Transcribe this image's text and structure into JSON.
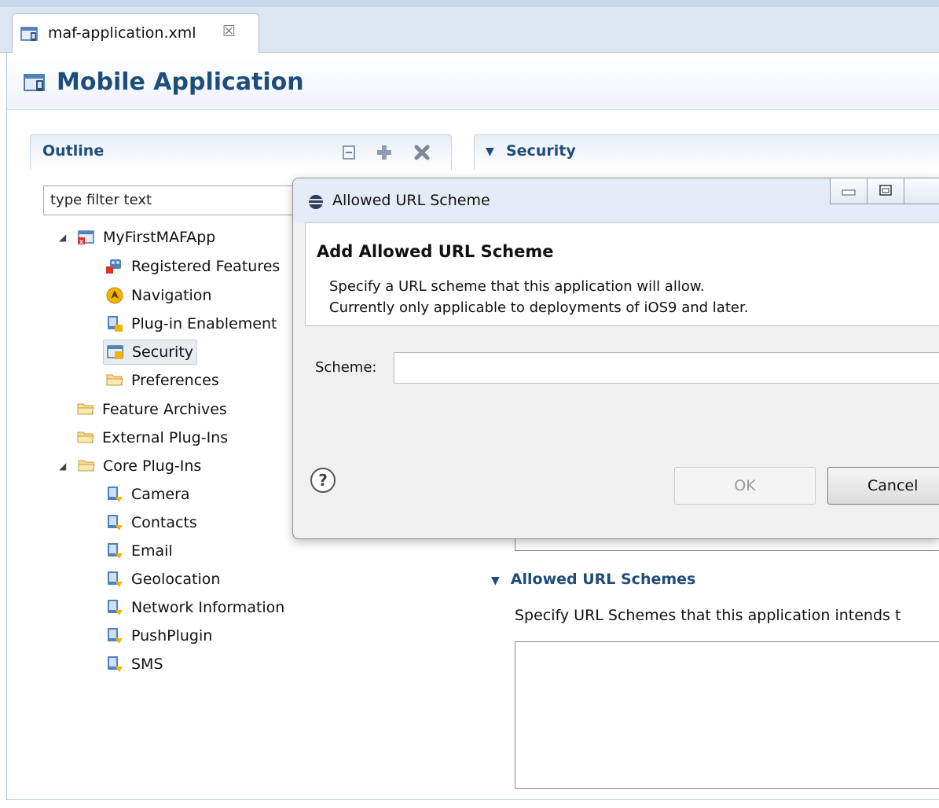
{
  "editor_tab": {
    "label": "maf-application.xml",
    "close": "☒"
  },
  "header": {
    "title": "Mobile Application"
  },
  "outline": {
    "title": "Outline",
    "filter_placeholder": "type filter text",
    "tree": [
      {
        "label": "MyFirstMAFApp",
        "icon": "app-icon",
        "expanded": true
      },
      {
        "label": "Registered Features",
        "icon": "feature-icon"
      },
      {
        "label": "Navigation",
        "icon": "navigation-icon"
      },
      {
        "label": "Plug-in Enablement",
        "icon": "plugin-lock-icon"
      },
      {
        "label": "Security",
        "icon": "security-icon",
        "selected": true
      },
      {
        "label": "Preferences",
        "icon": "folder-icon"
      },
      {
        "label": "Feature Archives",
        "icon": "folder-icon"
      },
      {
        "label": "External Plug-Ins",
        "icon": "folder-icon"
      },
      {
        "label": "Core Plug-Ins",
        "icon": "folder-icon",
        "expanded": true
      },
      {
        "label": "Camera",
        "icon": "plugin-icon"
      },
      {
        "label": "Contacts",
        "icon": "plugin-icon"
      },
      {
        "label": "Email",
        "icon": "plugin-icon"
      },
      {
        "label": "Geolocation",
        "icon": "plugin-icon"
      },
      {
        "label": "Network Information",
        "icon": "plugin-icon"
      },
      {
        "label": "PushPlugin",
        "icon": "plugin-icon"
      },
      {
        "label": "SMS",
        "icon": "plugin-icon"
      }
    ]
  },
  "security": {
    "title": "Security"
  },
  "allowed_url_schemes": {
    "title": "Allowed URL Schemes",
    "description": "Specify URL Schemes that this application intends t"
  },
  "dialog": {
    "title": "Allowed URL Scheme",
    "heading": "Add Allowed URL Scheme",
    "description_line1": "Specify a URL scheme that this application will allow.",
    "description_line2": "Currently only applicable to deployments of iOS9 and later.",
    "scheme_label": "Scheme:",
    "scheme_value": "",
    "ok_label": "OK",
    "cancel_label": "Cancel"
  },
  "colors": {
    "accent": "#1f4d7a",
    "tab_bar": "#dbe6f2",
    "dialog_bg": "#f0f0f0"
  }
}
